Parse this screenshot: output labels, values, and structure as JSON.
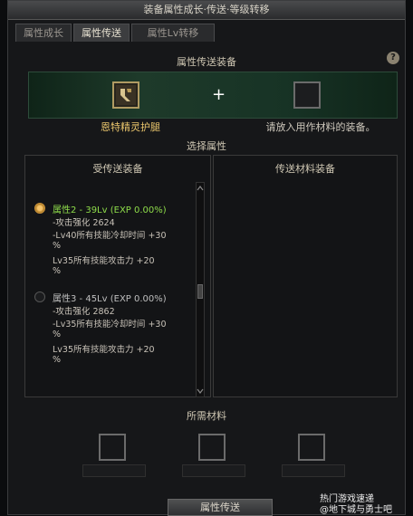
{
  "window": {
    "title": "装备属性成长·传送·等级转移"
  },
  "tabs": [
    {
      "label": "属性成长",
      "active": false
    },
    {
      "label": "属性传送",
      "active": true
    },
    {
      "label": "属性Lv转移",
      "active": false
    }
  ],
  "help": {
    "label": "?"
  },
  "transfer_equipment": {
    "title": "属性传送装备",
    "target_item_name": "恩特精灵护腿",
    "plus": "+",
    "hint": "请放入用作材料的装备。"
  },
  "select_attribute": {
    "title": "选择属性",
    "left_title": "受传送装备",
    "right_title": "传送材料装备",
    "options": [
      {
        "selected": true,
        "title": "属性2 - 39Lv (EXP 0.00%)",
        "lines": [
          "-攻击强化 2624",
          "-Lv40所有技能冷却时间 +30",
          "%",
          "Lv35所有技能攻击力 +20",
          "%"
        ]
      },
      {
        "selected": false,
        "title": "属性3 - 45Lv (EXP 0.00%)",
        "lines": [
          "-攻击强化 2862",
          "-Lv35所有技能冷却时间 +30",
          "%",
          "Lv35所有技能攻击力 +20",
          "%"
        ]
      }
    ]
  },
  "required_materials": {
    "title": "所需材料"
  },
  "main_button": {
    "label": "属性传送"
  },
  "watermark": {
    "line1": "热门游戏速递",
    "line2": "@地下城与勇士吧"
  }
}
